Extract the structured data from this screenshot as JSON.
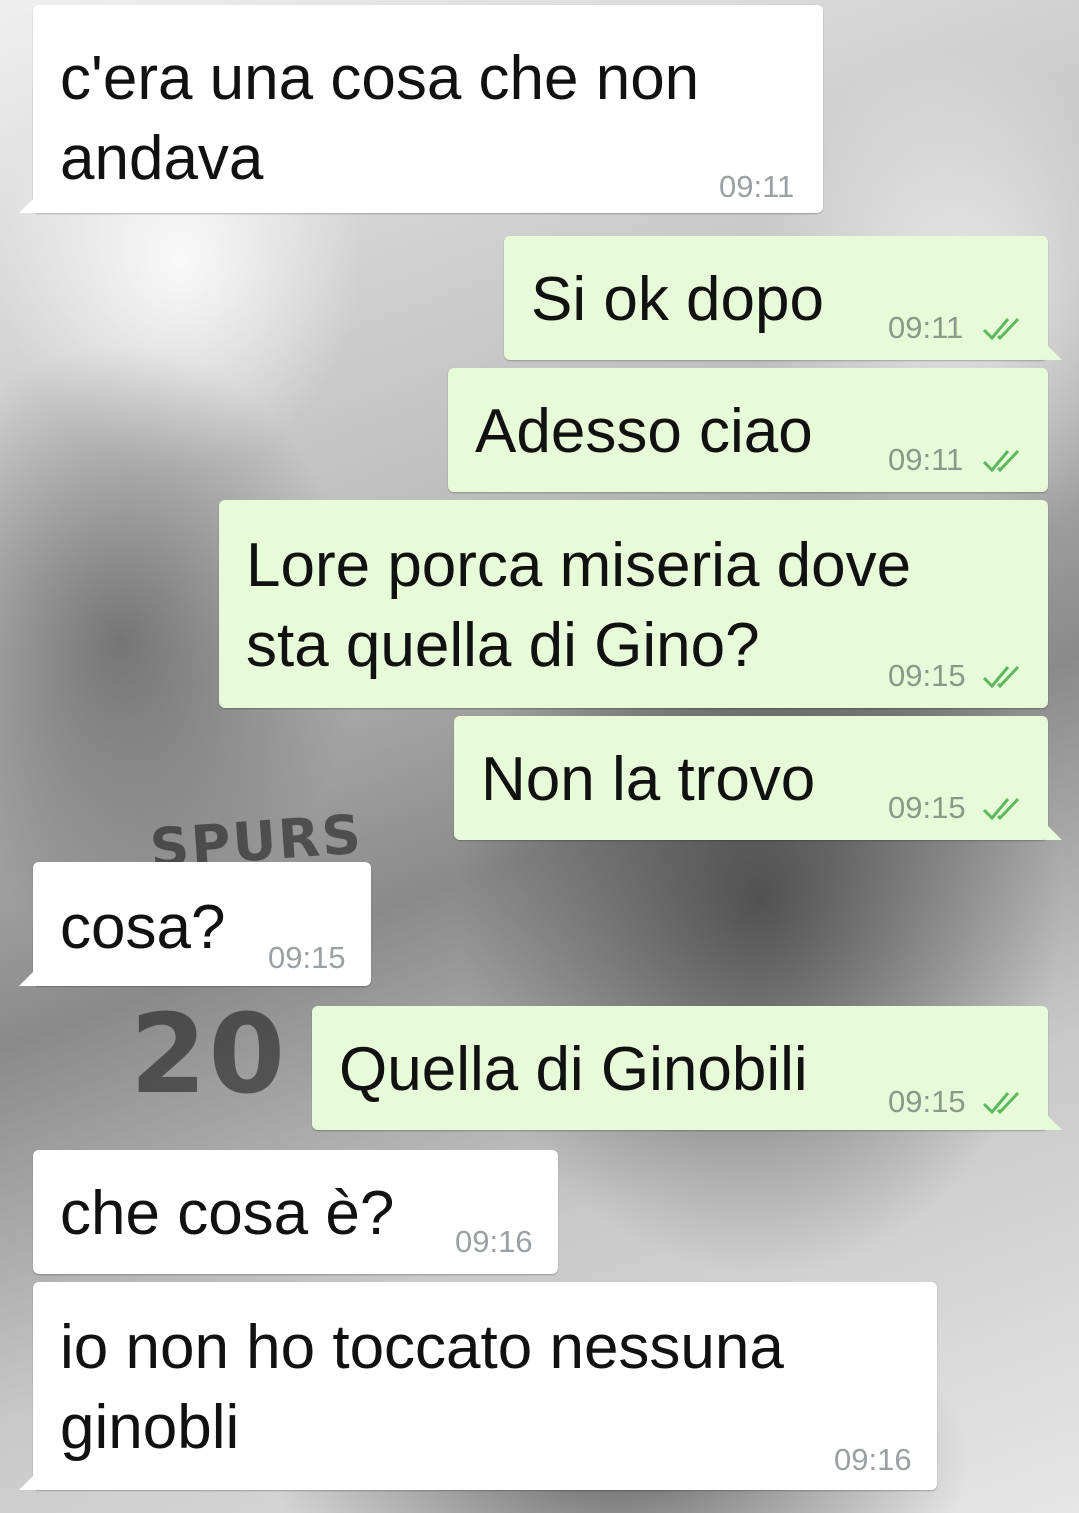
{
  "conversation": {
    "messages": [
      {
        "direction": "incoming",
        "lines": [
          "c'era una cosa che non",
          "andava"
        ],
        "time": "09:11"
      },
      {
        "direction": "outgoing",
        "lines": [
          "Si ok dopo"
        ],
        "time": "09:11",
        "status_icon": "double-check-icon"
      },
      {
        "direction": "outgoing",
        "lines": [
          "Adesso ciao"
        ],
        "time": "09:11",
        "status_icon": "double-check-icon"
      },
      {
        "direction": "outgoing",
        "lines": [
          "Lore porca miseria dove",
          "sta quella di Gino?"
        ],
        "time": "09:15",
        "status_icon": "double-check-icon"
      },
      {
        "direction": "outgoing",
        "lines": [
          "Non la trovo"
        ],
        "time": "09:15",
        "status_icon": "double-check-icon"
      },
      {
        "direction": "incoming",
        "lines": [
          "cosa?"
        ],
        "time": "09:15"
      },
      {
        "direction": "outgoing",
        "lines": [
          "Quella di Ginobili"
        ],
        "time": "09:15",
        "status_icon": "double-check-icon"
      },
      {
        "direction": "incoming",
        "lines": [
          "che cosa è?"
        ],
        "time": "09:16"
      },
      {
        "direction": "incoming",
        "lines": [
          "io non ho toccato nessuna",
          "ginobli"
        ],
        "time": "09:16"
      }
    ]
  },
  "colors": {
    "incoming_bubble": "#ffffff",
    "outgoing_bubble": "#e7fbd9",
    "read_tick": "#4fc3f7",
    "delivered_tick": "#5cb85c",
    "timestamp": "#9aa0a3"
  },
  "wallpaper": {
    "jersey_text_1": "SPURS",
    "jersey_number": "20"
  }
}
